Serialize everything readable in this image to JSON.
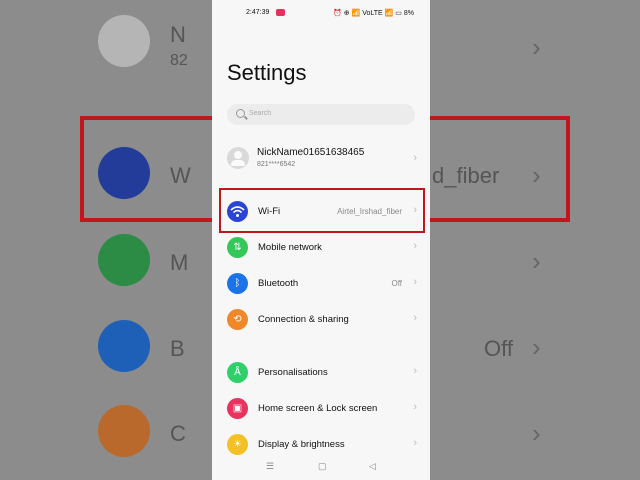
{
  "background": {
    "top_name_partial": "N",
    "top_number_partial": "82",
    "wifi_partial": "W",
    "wifi_value_partial": "d_fiber",
    "mobile_partial": "M",
    "bluetooth_partial": "B",
    "bluetooth_value": "Off",
    "connection_partial": "C"
  },
  "status_bar": {
    "time": "2:47:39",
    "right_icons": "⏰ ⊕ 📶 VoLTE 📶 ▭ 8%"
  },
  "page": {
    "title": "Settings",
    "search_placeholder": "Search"
  },
  "profile": {
    "name": "NickName01651638465",
    "number": "821****6542"
  },
  "items": [
    {
      "id": "wifi",
      "label": "Wi-Fi",
      "value": "Airtel_Irshad_fiber",
      "color": "#2a45d6"
    },
    {
      "id": "mobile-network",
      "label": "Mobile network",
      "value": "",
      "color": "#34c759"
    },
    {
      "id": "bluetooth",
      "label": "Bluetooth",
      "value": "Off",
      "color": "#1a73e8"
    },
    {
      "id": "connection-sharing",
      "label": "Connection & sharing",
      "value": "",
      "color": "#f0882a"
    },
    {
      "id": "personalisations",
      "label": "Personalisations",
      "value": "",
      "color": "#2fcf6a"
    },
    {
      "id": "home-lock",
      "label": "Home screen & Lock screen",
      "value": "",
      "color": "#e8335f"
    },
    {
      "id": "display",
      "label": "Display & brightness",
      "value": "",
      "color": "#f3c125"
    }
  ],
  "nav": {
    "menu": "☰",
    "home": "▢",
    "back": "◁"
  }
}
